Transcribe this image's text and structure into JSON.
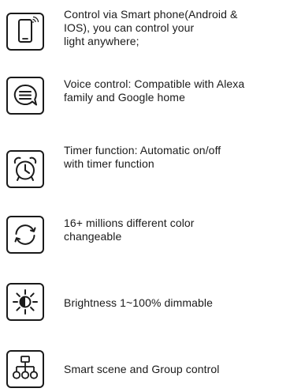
{
  "features": [
    {
      "icon": "smartphone-icon",
      "lines": [
        "Control via Smart phone(Android &",
        "IOS), you can control your",
        "light anywhere;"
      ]
    },
    {
      "icon": "chat-bubble-icon",
      "lines": [
        "Voice control: Compatible with Alexa",
        "family and Google home"
      ]
    },
    {
      "icon": "alarm-clock-icon",
      "lines": [
        "Timer function: Automatic on/off",
        "with timer function"
      ]
    },
    {
      "icon": "refresh-cycle-icon",
      "lines": [
        "16+ millions different color",
        "changeable"
      ]
    },
    {
      "icon": "brightness-icon",
      "lines": [
        "Brightness 1~100% dimmable"
      ]
    },
    {
      "icon": "network-hierarchy-icon",
      "lines": [
        "Smart scene and Group control"
      ]
    }
  ]
}
